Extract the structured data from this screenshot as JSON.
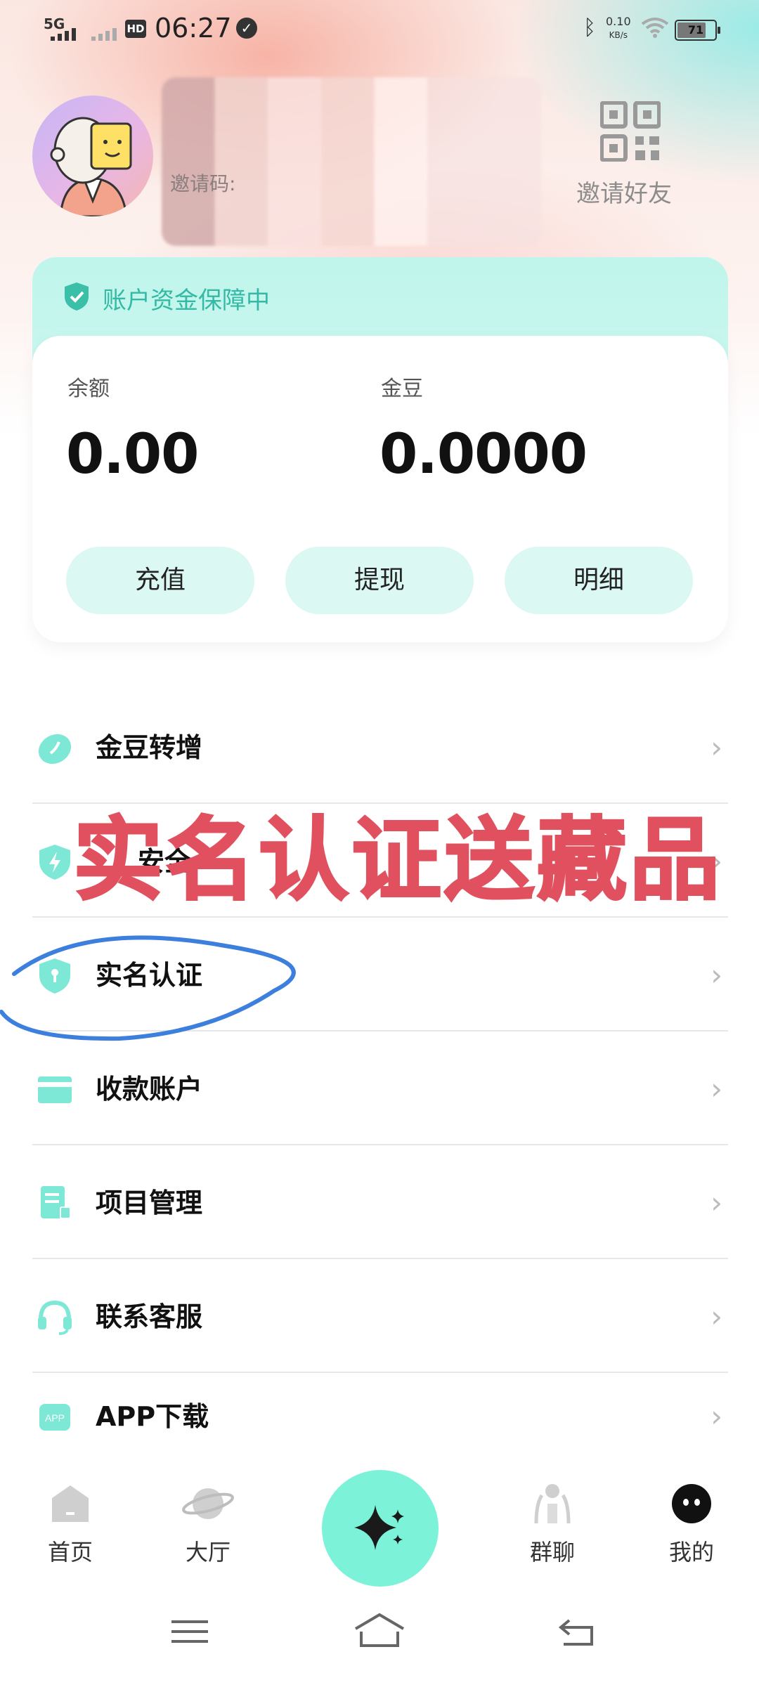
{
  "status_bar": {
    "network": "5G",
    "hd": "HD",
    "time": "06:27",
    "speed_value": "0.10",
    "speed_unit": "KB/s",
    "battery": "71"
  },
  "profile": {
    "invite_code": "邀请码:",
    "invite_friends": "邀请好友"
  },
  "account": {
    "protection_text": "账户资金保障中",
    "balance_label": "余额",
    "balance_value": "0.00",
    "beans_label": "金豆",
    "beans_value": "0.0000",
    "buttons": [
      "充值",
      "提现",
      "明细"
    ]
  },
  "menu": [
    {
      "label": "金豆转增",
      "icon": "bean-icon"
    },
    {
      "label": "安全",
      "icon": "lightning-shield-icon"
    },
    {
      "label": "实名认证",
      "icon": "shield-key-icon"
    },
    {
      "label": "收款账户",
      "icon": "card-icon"
    },
    {
      "label": "项目管理",
      "icon": "document-icon"
    },
    {
      "label": "联系客服",
      "icon": "headset-icon"
    },
    {
      "label": "APP下载",
      "icon": "app-icon"
    }
  ],
  "overlay_text": "实名认证送藏品",
  "bottom_nav": {
    "items": [
      "首页",
      "大厅",
      "群聊",
      "我的"
    ]
  },
  "colors": {
    "accent": "#7cf2d9",
    "accent_text": "#35b9a4",
    "overlay_red": "#e0505e",
    "annotation_blue": "#3d7fdc"
  }
}
